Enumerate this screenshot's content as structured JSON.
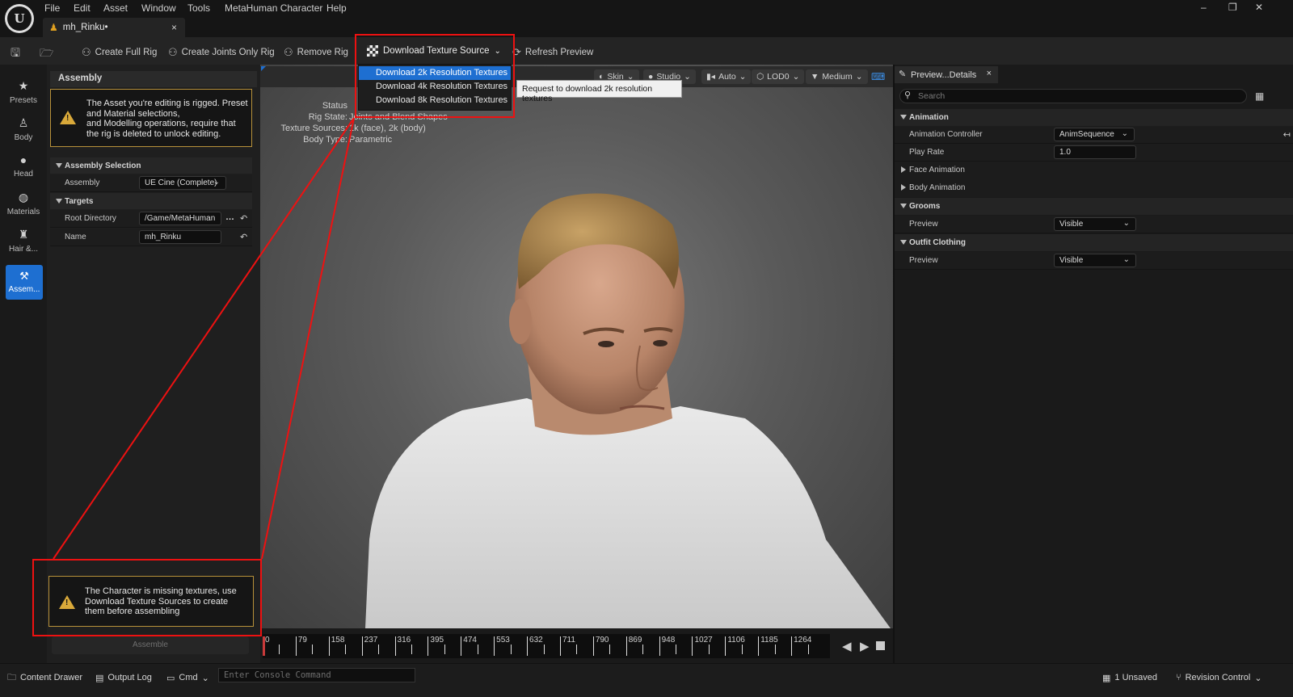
{
  "menu": [
    "File",
    "Edit",
    "Asset",
    "Window",
    "Tools",
    "MetaHuman Character",
    "Help"
  ],
  "document_tab": {
    "label": "mh_Rinku•",
    "close": "×"
  },
  "window_controls": {
    "minimize": "–",
    "restore": "❐",
    "close": "✕"
  },
  "toolbar": {
    "create_full_rig": "Create Full Rig",
    "create_joints_only_rig": "Create Joints Only Rig",
    "remove_rig": "Remove Rig",
    "download_texture_source": "Download Texture Source",
    "refresh_preview": "Refresh Preview"
  },
  "dropdown": {
    "items": [
      "Download 2k Resolution Textures",
      "Download 4k Resolution Textures",
      "Download 8k Resolution Textures"
    ],
    "selected_index": 0,
    "tooltip": "Request to download 2k resolution textures"
  },
  "rail": {
    "items": [
      {
        "label": "Presets",
        "icon": "star-icon"
      },
      {
        "label": "Body",
        "icon": "body-icon"
      },
      {
        "label": "Head",
        "icon": "head-icon"
      },
      {
        "label": "Materials",
        "icon": "materials-icon"
      },
      {
        "label": "Hair &...",
        "icon": "hair-icon"
      },
      {
        "label": "Assem...",
        "icon": "assembly-icon"
      }
    ]
  },
  "assembly_panel": {
    "header": "Assembly",
    "warning_rigged": "The Asset you're editing is rigged. Preset and Material selections,\nand Modelling operations, require that the rig is deleted to unlock editing.",
    "warning_rigged_lines": [
      "The Asset you're editing is rigged. Preset",
      "and Material selections,",
      "and Modelling operations, require that",
      "the rig is deleted to unlock editing."
    ],
    "section_selection": "Assembly Selection",
    "assembly_label": "Assembly",
    "assembly_value": "UE Cine (Complete)",
    "section_targets": "Targets",
    "root_dir_label": "Root Directory",
    "root_dir_value": "/Game/MetaHuman",
    "name_label": "Name",
    "name_value": "mh_Rinku",
    "warning_textures_lines": [
      "The Character is missing textures, use",
      "Download Texture Sources to create",
      "them before assembling"
    ],
    "assemble_button": "Assemble"
  },
  "viewport": {
    "pills": [
      "Skin",
      "Studio",
      "Auto",
      "LOD0",
      "Medium"
    ],
    "status_title": "Status",
    "status": [
      {
        "key": "Rig State:",
        "value": "Joints and Blend Shapes"
      },
      {
        "key": "Texture Sources:",
        "value": "1k (face), 2k (body)"
      },
      {
        "key": "Body Type:",
        "value": "Parametric"
      }
    ]
  },
  "timeline": {
    "ticks": [
      0,
      79,
      158,
      237,
      316,
      395,
      474,
      553,
      632,
      711,
      790,
      869,
      948,
      1027,
      1106,
      1185,
      1264
    ]
  },
  "details": {
    "tab_label": "Preview...Details",
    "tab_close": "×",
    "search_placeholder": "Search",
    "sec_animation": "Animation",
    "anim_controller_label": "Animation Controller",
    "anim_controller_value": "AnimSequence",
    "play_rate_label": "Play Rate",
    "play_rate_value": "1.0",
    "face_animation": "Face Animation",
    "body_animation": "Body Animation",
    "sec_grooms": "Grooms",
    "grooms_preview_label": "Preview",
    "grooms_preview_value": "Visible",
    "sec_outfit": "Outfit Clothing",
    "outfit_preview_label": "Preview",
    "outfit_preview_value": "Visible"
  },
  "statusbar": {
    "content_drawer": "Content Drawer",
    "output_log": "Output Log",
    "cmd": "Cmd",
    "console_placeholder": "Enter Console Command",
    "unsaved": "1 Unsaved",
    "revision_control": "Revision Control"
  },
  "colors": {
    "accent": "#1e6fd1",
    "annotation": "#e11111",
    "warning": "#d9a93a"
  }
}
